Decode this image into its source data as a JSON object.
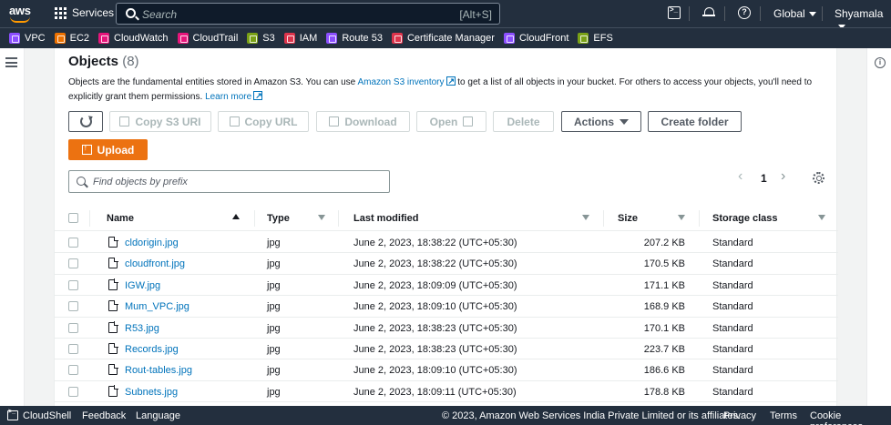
{
  "topnav": {
    "logo": "aws",
    "services_label": "Services",
    "search_placeholder": "Search",
    "search_shortcut": "[Alt+S]",
    "region_label": "Global",
    "user_label": "Shyamala"
  },
  "favorites": [
    {
      "label": "VPC",
      "color": "#8c4fff"
    },
    {
      "label": "EC2",
      "color": "#ed7100"
    },
    {
      "label": "CloudWatch",
      "color": "#e7157b"
    },
    {
      "label": "CloudTrail",
      "color": "#e7157b"
    },
    {
      "label": "S3",
      "color": "#7aa116"
    },
    {
      "label": "IAM",
      "color": "#dd344c"
    },
    {
      "label": "Route 53",
      "color": "#8c4fff"
    },
    {
      "label": "Certificate Manager",
      "color": "#dd344c"
    },
    {
      "label": "CloudFront",
      "color": "#8c4fff"
    },
    {
      "label": "EFS",
      "color": "#7aa116"
    }
  ],
  "objects": {
    "title": "Objects",
    "count": "(8)",
    "desc_part1": "Objects are the fundamental entities stored in Amazon S3. You can use ",
    "inventory_link": "Amazon S3 inventory",
    "desc_part2": " to get a list of all objects in your bucket. For others to access your objects, you'll need to explicitly grant them permissions. ",
    "learn_more": "Learn more"
  },
  "actions": {
    "copy_s3_uri": "Copy S3 URI",
    "copy_url": "Copy URL",
    "download": "Download",
    "open": "Open",
    "delete": "Delete",
    "actions": "Actions",
    "create_folder": "Create folder",
    "upload": "Upload"
  },
  "filter": {
    "placeholder": "Find objects by prefix"
  },
  "pagination": {
    "prev": "‹",
    "page": "1",
    "next": "›"
  },
  "table": {
    "headers": {
      "name": "Name",
      "type": "Type",
      "last_modified": "Last modified",
      "size": "Size",
      "storage_class": "Storage class"
    },
    "rows": [
      {
        "name": "cldorigin.jpg",
        "type": "jpg",
        "modified": "June 2, 2023, 18:38:22 (UTC+05:30)",
        "size": "207.2 KB",
        "storage": "Standard"
      },
      {
        "name": "cloudfront.jpg",
        "type": "jpg",
        "modified": "June 2, 2023, 18:38:22 (UTC+05:30)",
        "size": "170.5 KB",
        "storage": "Standard"
      },
      {
        "name": "IGW.jpg",
        "type": "jpg",
        "modified": "June 2, 2023, 18:09:09 (UTC+05:30)",
        "size": "171.1 KB",
        "storage": "Standard"
      },
      {
        "name": "Mum_VPC.jpg",
        "type": "jpg",
        "modified": "June 2, 2023, 18:09:10 (UTC+05:30)",
        "size": "168.9 KB",
        "storage": "Standard"
      },
      {
        "name": "R53.jpg",
        "type": "jpg",
        "modified": "June 2, 2023, 18:38:23 (UTC+05:30)",
        "size": "170.1 KB",
        "storage": "Standard"
      },
      {
        "name": "Records.jpg",
        "type": "jpg",
        "modified": "June 2, 2023, 18:38:23 (UTC+05:30)",
        "size": "223.7 KB",
        "storage": "Standard"
      },
      {
        "name": "Rout-tables.jpg",
        "type": "jpg",
        "modified": "June 2, 2023, 18:09:10 (UTC+05:30)",
        "size": "186.6 KB",
        "storage": "Standard"
      },
      {
        "name": "Subnets.jpg",
        "type": "jpg",
        "modified": "June 2, 2023, 18:09:11 (UTC+05:30)",
        "size": "178.8 KB",
        "storage": "Standard"
      }
    ]
  },
  "footer": {
    "cloudshell": "CloudShell",
    "feedback": "Feedback",
    "language": "Language",
    "copyright": "© 2023, Amazon Web Services India Private Limited or its affiliates.",
    "privacy": "Privacy",
    "terms": "Terms",
    "cookie": "Cookie preferences"
  },
  "colors": {
    "nav_bg": "#232f3e",
    "primary": "#ec7211",
    "link": "#0073bb"
  }
}
